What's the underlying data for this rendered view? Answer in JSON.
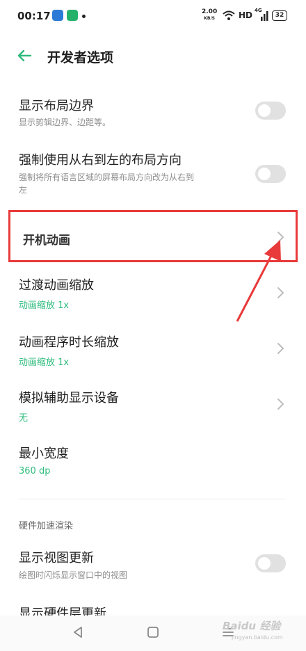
{
  "status_bar": {
    "time": "00:17",
    "speed_value": "2.00",
    "speed_unit": "KB/S",
    "hd": "HD",
    "network": "4G",
    "battery": "32",
    "icons": [
      "app-notification-icon",
      "app-notification-icon",
      "dot-icon",
      "wifi-icon",
      "signal-icon",
      "battery-icon"
    ]
  },
  "header": {
    "back_icon": "back-arrow-icon",
    "title": "开发者选项"
  },
  "items": [
    {
      "title": "显示布局边界",
      "subtitle": "显示剪辑边界、边距等。",
      "control": "toggle",
      "checked": false
    },
    {
      "title": "强制使用从右到左的布局方向",
      "subtitle_line1": "强制将所有语言区域的屏幕布局方向改为从右到",
      "subtitle_line2": "左",
      "control": "toggle",
      "checked": false
    },
    {
      "title": "开机动画",
      "control": "chevron",
      "highlighted": true
    },
    {
      "title": "过渡动画缩放",
      "value": "动画缩放 1x",
      "control": "chevron"
    },
    {
      "title": "动画程序时长缩放",
      "value": "动画缩放 1x",
      "control": "chevron"
    },
    {
      "title": "模拟辅助显示设备",
      "value": "无",
      "control": "chevron"
    },
    {
      "title": "最小宽度",
      "value": "360 dp"
    }
  ],
  "section": {
    "header": "硬件加速渲染",
    "items": [
      {
        "title": "显示视图更新",
        "subtitle": "绘图时闪烁显示窗口中的视图",
        "control": "toggle",
        "checked": false
      },
      {
        "title": "显示硬件层更新"
      }
    ]
  },
  "nav_bar": {
    "icons": [
      "back-triangle-icon",
      "home-square-icon",
      "recents-menu-icon"
    ]
  },
  "watermark": {
    "text": "Baidu 经验",
    "sub": "jingyan.baidu.com"
  },
  "colors": {
    "accent": "#2dbb7c",
    "highlight": "#e83a3a",
    "toggle_off": "#e1e1e1"
  }
}
